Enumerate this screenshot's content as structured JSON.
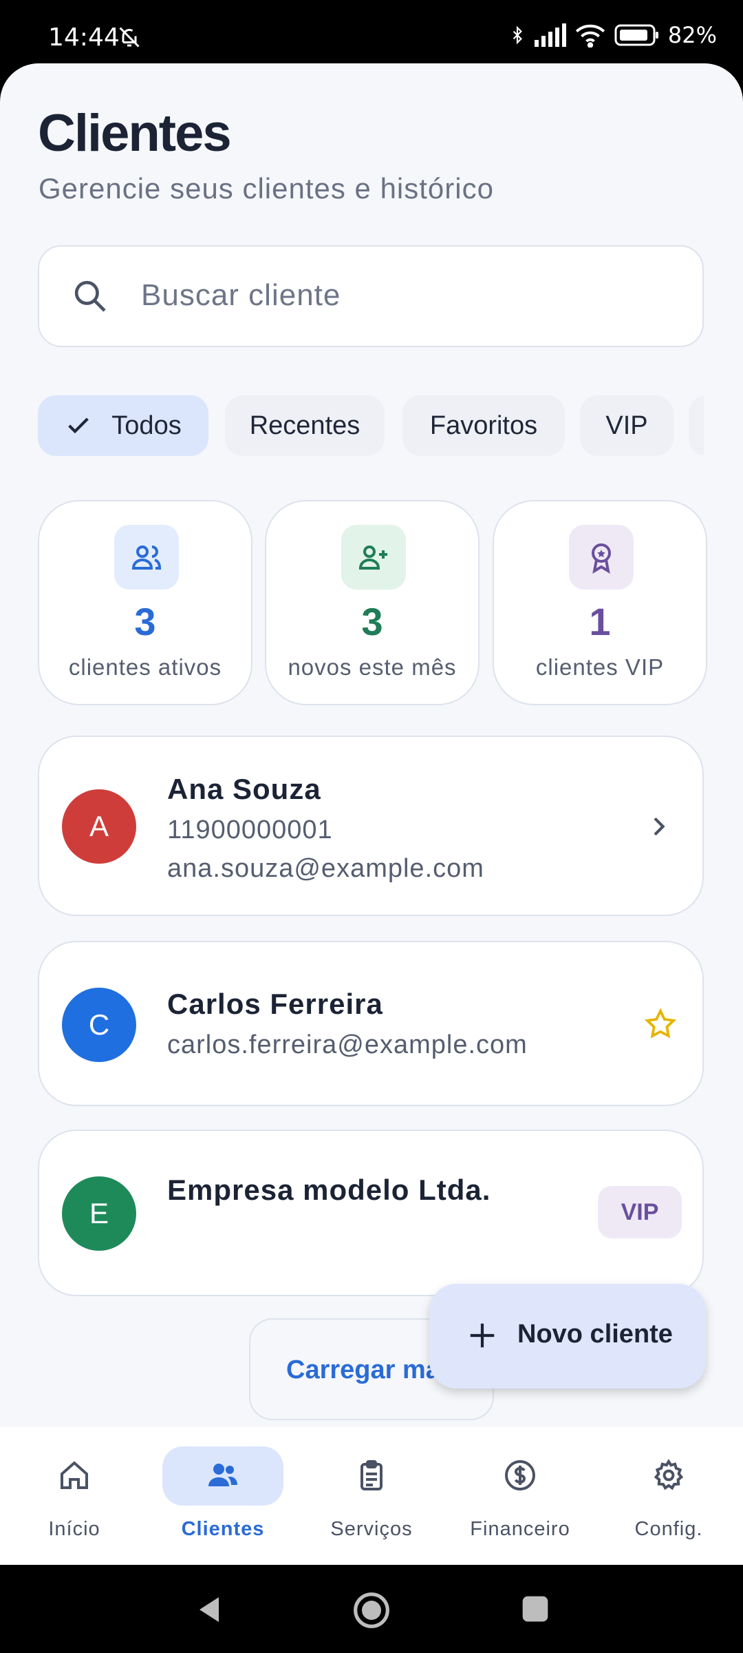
{
  "status_bar": {
    "time": "14:44",
    "battery": "82%"
  },
  "header": {
    "title": "Clientes",
    "subtitle": "Gerencie seus clientes e histórico"
  },
  "search": {
    "placeholder": "Buscar cliente"
  },
  "filters": [
    {
      "label": "Todos",
      "selected": true
    },
    {
      "label": "Recentes",
      "selected": false
    },
    {
      "label": "Favoritos",
      "selected": false
    },
    {
      "label": "VIP",
      "selected": false
    }
  ],
  "stats": [
    {
      "value": "3",
      "label": "clientes ativos",
      "color": "#2a6bd6",
      "icon": "users-icon"
    },
    {
      "value": "3",
      "label": "novos este mês",
      "color": "#1f7d57",
      "icon": "user-plus-icon"
    },
    {
      "value": "1",
      "label": "clientes VIP",
      "color": "#6a4f9e",
      "icon": "award-icon"
    }
  ],
  "clients": [
    {
      "initial": "A",
      "name": "Ana Souza",
      "phone": "11900000001",
      "email": "ana.souza@example.com",
      "avatar_color": "#cf3d3a",
      "trailing": "chevron-right-icon"
    },
    {
      "initial": "C",
      "name": "Carlos Ferreira",
      "email": "carlos.ferreira@example.com",
      "avatar_color": "#1f6fe0",
      "trailing": "star-icon"
    },
    {
      "initial": "E",
      "name": "Empresa modelo Ltda.",
      "avatar_color": "#1e8a5a",
      "badge": "VIP"
    }
  ],
  "load_more": "Carregar mais",
  "fab": {
    "label": "Novo cliente"
  },
  "bottom_nav": [
    {
      "label": "Início",
      "icon": "home-icon",
      "active": false
    },
    {
      "label": "Clientes",
      "icon": "users-icon",
      "active": true
    },
    {
      "label": "Serviços",
      "icon": "clipboard-icon",
      "active": false
    },
    {
      "label": "Financeiro",
      "icon": "dollar-icon",
      "active": false
    },
    {
      "label": "Config.",
      "icon": "gear-icon",
      "active": false
    }
  ]
}
